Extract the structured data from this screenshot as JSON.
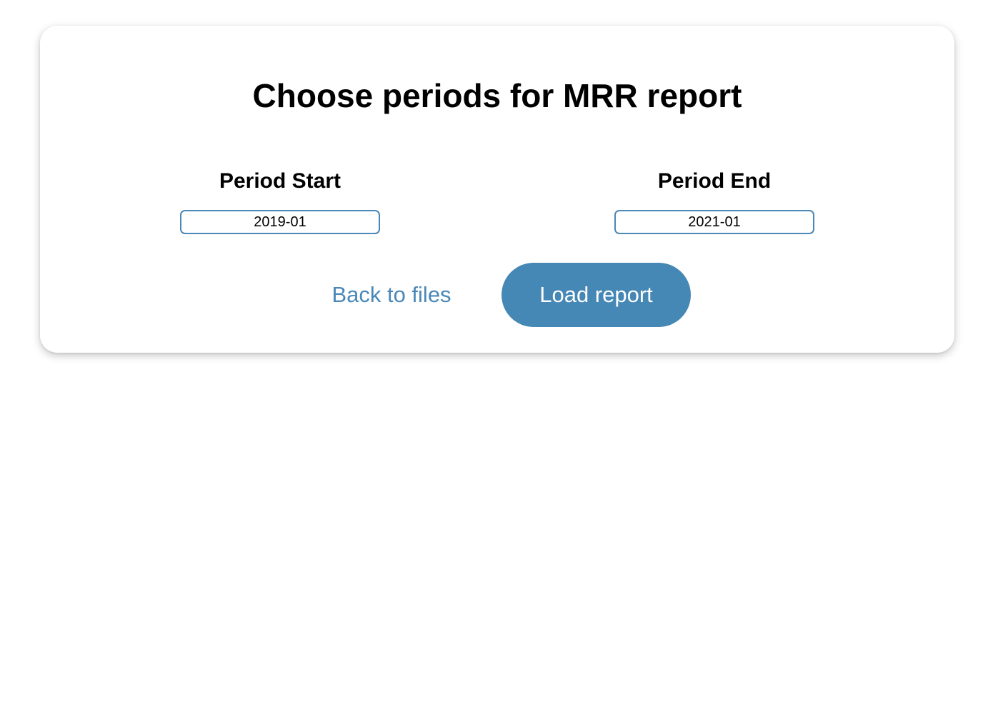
{
  "form": {
    "title": "Choose periods for MRR report",
    "period_start": {
      "label": "Period Start",
      "value": "2019-01"
    },
    "period_end": {
      "label": "Period End",
      "value": "2021-01"
    },
    "back_label": "Back to files",
    "load_label": "Load report"
  },
  "colors": {
    "accent": "#4587b5",
    "text": "#000000",
    "background": "#ffffff"
  }
}
